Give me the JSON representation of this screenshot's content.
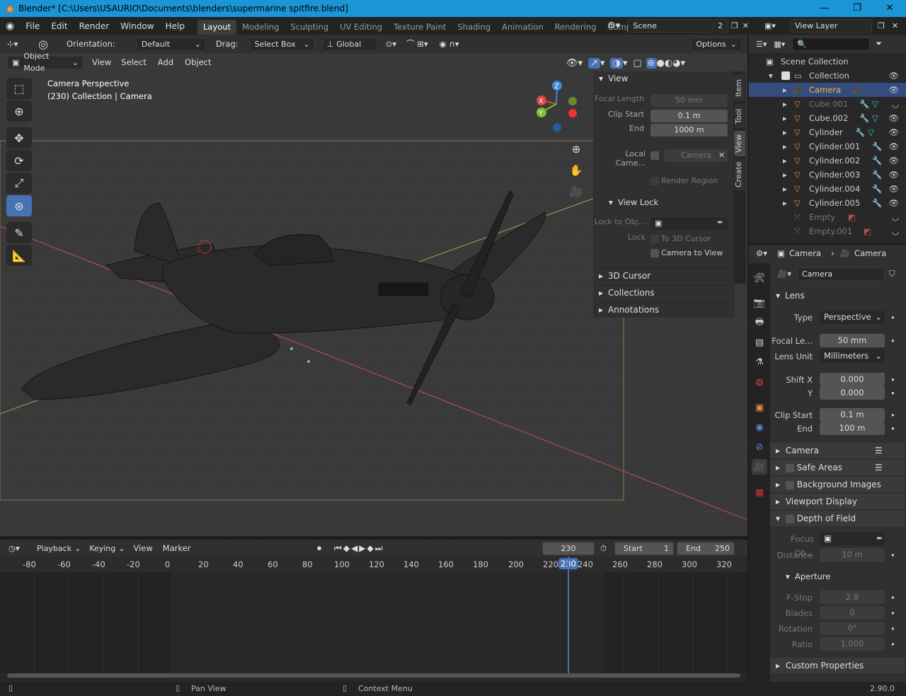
{
  "window": {
    "title": "Blender* [C:\\Users\\USAURIO\\Documents\\blenders\\supermarine spitfire.blend]",
    "controls": [
      "—",
      "❐",
      "✕"
    ]
  },
  "menu": {
    "items": [
      "File",
      "Edit",
      "Render",
      "Window",
      "Help"
    ]
  },
  "workspaces": [
    "Layout",
    "Modeling",
    "Sculpting",
    "UV Editing",
    "Texture Paint",
    "Shading",
    "Animation",
    "Rendering",
    "Composit"
  ],
  "scene": {
    "name": "Scene",
    "count": "2"
  },
  "view_layer": {
    "name": "View Layer"
  },
  "toolheader": {
    "orientation_label": "Orientation:",
    "orientation": "Default",
    "drag_label": "Drag:",
    "drag": "Select Box",
    "transform": "Global",
    "options": "Options"
  },
  "viewport_header": {
    "mode": "Object Mode",
    "menus": [
      "View",
      "Select",
      "Add",
      "Object"
    ]
  },
  "viewport": {
    "camera_label": "Camera Perspective",
    "collection_label": "(230) Collection | Camera"
  },
  "gizmo": {
    "z": "Z",
    "x": "X",
    "y": "Y"
  },
  "npanel": {
    "view_title": "View",
    "focal_length_label": "Focal Length",
    "focal_length": "50 mm",
    "clip_start_label": "Clip Start",
    "clip_start": "0.1 m",
    "end_label": "End",
    "end": "1000 m",
    "local_camera_label": "Local Came...",
    "local_camera": "Camera",
    "render_region": "Render Region",
    "view_lock_title": "View Lock",
    "lock_to_obj_label": "Lock to Obj...",
    "lock_label": "Lock",
    "to_3d_cursor": "To 3D Cursor",
    "camera_to_view": "Camera to View",
    "cursor_3d": "3D Cursor",
    "collections": "Collections",
    "annotations": "Annotations",
    "tabs": [
      "Item",
      "Tool",
      "View",
      "Create"
    ]
  },
  "timeline": {
    "menus": [
      "Playback",
      "Keying",
      "View",
      "Marker"
    ],
    "current": "230",
    "start_label": "Start",
    "start": "1",
    "end_label": "End",
    "end": "250",
    "ticks": [
      "-80",
      "-60",
      "-40",
      "-20",
      "0",
      "20",
      "40",
      "60",
      "80",
      "100",
      "120",
      "140",
      "160",
      "180",
      "200",
      "220",
      "240",
      "260",
      "280",
      "300",
      "320"
    ],
    "playhead": "230"
  },
  "status": {
    "pan": "Pan View",
    "context": "Context Menu",
    "version": "2.90.0"
  },
  "outliner": {
    "root": "Scene Collection",
    "collection": "Collection",
    "items": [
      {
        "name": "Camera",
        "selected": true
      },
      {
        "name": "Cube.001",
        "dim": true
      },
      {
        "name": "Cube.002"
      },
      {
        "name": "Cylinder"
      },
      {
        "name": "Cylinder.001"
      },
      {
        "name": "Cylinder.002"
      },
      {
        "name": "Cylinder.003"
      },
      {
        "name": "Cylinder.004"
      },
      {
        "name": "Cylinder.005"
      },
      {
        "name": "Empty",
        "dim": true
      },
      {
        "name": "Empty.001",
        "dim": true
      }
    ]
  },
  "properties": {
    "breadcrumb_obj": "Camera",
    "breadcrumb_data": "Camera",
    "datablock": "Camera",
    "lens_title": "Lens",
    "type_label": "Type",
    "type": "Perspective",
    "focal_label": "Focal Le...",
    "focal": "50 mm",
    "lens_unit_label": "Lens Unit",
    "lens_unit": "Millimeters",
    "shift_x_label": "Shift X",
    "shift_x": "0.000",
    "shift_y_label": "Y",
    "shift_y": "0.000",
    "clip_start_label": "Clip Start",
    "clip_start": "0.1 m",
    "clip_end_label": "End",
    "clip_end": "100 m",
    "camera_title": "Camera",
    "safe_areas": "Safe Areas",
    "background_images": "Background Images",
    "viewport_display": "Viewport Display",
    "dof": "Depth of Field",
    "focus_label": "Focus Ob...",
    "distance_label": "Distance",
    "distance": "10 m",
    "aperture_title": "Aperture",
    "fstop_label": "F-Stop",
    "fstop": "2.8",
    "blades_label": "Blades",
    "blades": "0",
    "rotation_label": "Rotation",
    "rotation": "0°",
    "ratio_label": "Ratio",
    "ratio": "1.000",
    "custom_props": "Custom Properties"
  }
}
